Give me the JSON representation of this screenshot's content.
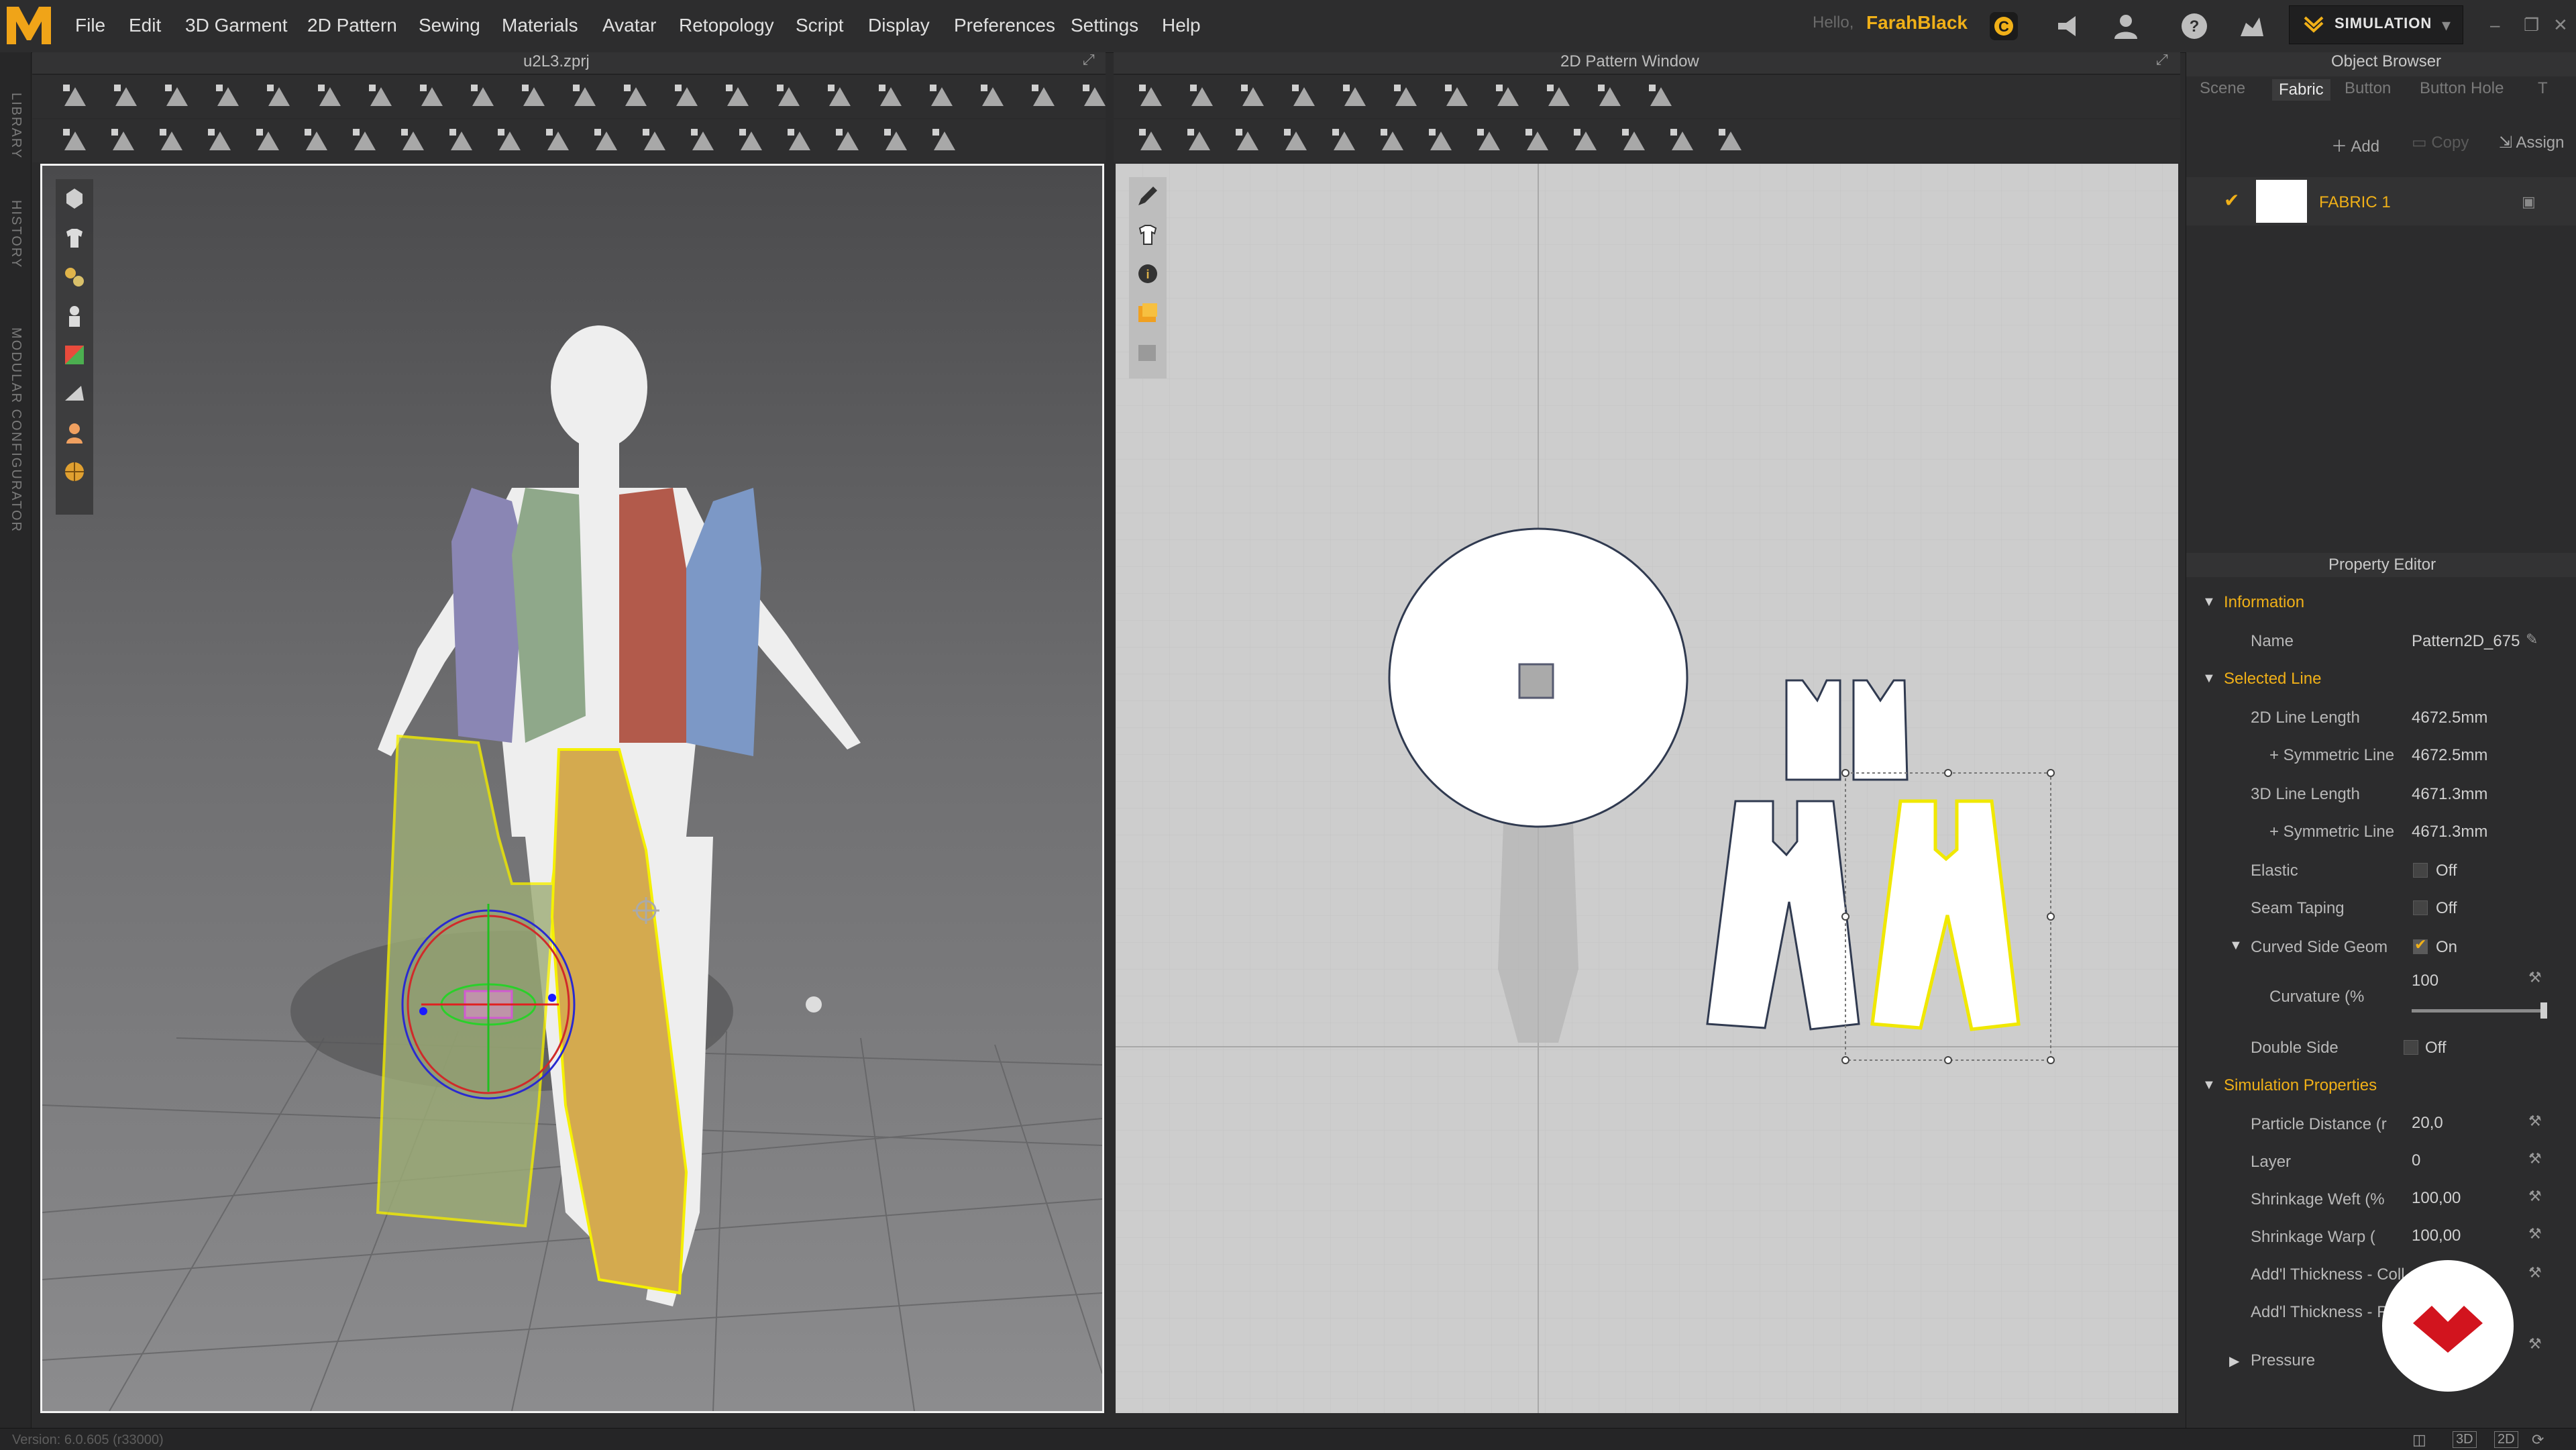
{
  "menu": {
    "items": [
      "File",
      "Edit",
      "3D Garment",
      "2D Pattern",
      "Sewing",
      "Materials",
      "Avatar",
      "Retopology",
      "Script",
      "Display",
      "Preferences",
      "Settings",
      "Help"
    ],
    "hello": "Hello,",
    "user": "FarahBlack",
    "mode": "SIMULATION"
  },
  "left_strip": {
    "library": "LIBRARY",
    "history": "HISTORY",
    "modular": "MODULAR CONFIGURATOR"
  },
  "viewport3d": {
    "title": "u2L3.zprj"
  },
  "viewport2d": {
    "title": "2D Pattern Window"
  },
  "object_browser": {
    "title": "Object Browser",
    "tabs": [
      "Scene",
      "Fabric",
      "Button",
      "Button Hole",
      "T"
    ],
    "active_tab": "Fabric",
    "actions": {
      "add": "Add",
      "copy": "Copy",
      "assign": "Assign"
    },
    "fabric_name": "FABRIC 1"
  },
  "property_editor": {
    "title": "Property Editor",
    "information": {
      "label": "Information",
      "name_label": "Name",
      "name_value": "Pattern2D_675"
    },
    "selected_line": {
      "label": "Selected Line",
      "line2d_label": "2D Line Length",
      "line2d_value": "4672.5mm",
      "sym2d_label": "+ Symmetric Line",
      "sym2d_value": "4672.5mm",
      "line3d_label": "3D Line Length",
      "line3d_value": "4671.3mm",
      "sym3d_label": "+ Symmetric Line",
      "sym3d_value": "4671.3mm",
      "elastic_label": "Elastic",
      "elastic_value": "Off",
      "seam_label": "Seam Taping",
      "seam_value": "Off",
      "curved_label": "Curved Side Geom",
      "curved_value": "On",
      "curvature_label": "Curvature (%",
      "curvature_value": "100",
      "double_label": "Double Side",
      "double_value": "Off"
    },
    "simulation": {
      "label": "Simulation Properties",
      "particle_label": "Particle Distance (r",
      "particle_value": "20,0",
      "layer_label": "Layer",
      "layer_value": "0",
      "weft_label": "Shrinkage Weft (%",
      "weft_value": "100,00",
      "warp_label": "Shrinkage Warp (",
      "warp_value": "100,00",
      "thick1_label": "Add'l Thickness - Coll",
      "thick2_label": "Add'l Thickness - R",
      "pressure_label": "Pressure"
    }
  },
  "status": {
    "version": "Version: 6.0.605 (r33000)"
  },
  "colors": {
    "accent": "#f0b018",
    "selection": "#f5f000",
    "bg": "#2b2b2c"
  }
}
